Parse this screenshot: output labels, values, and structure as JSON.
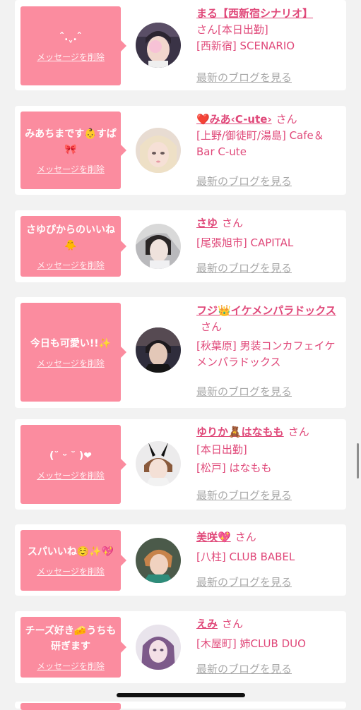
{
  "ui": {
    "delete_label": "メッセージを削除",
    "blog_label": "最新のブログを見る",
    "honorific": "さん"
  },
  "colors": {
    "bubble": "#fb8c9f",
    "accent": "#e0497a",
    "muted": "#a8a8a8",
    "background": "#f2f2f2"
  },
  "messages": [
    {
      "message": "ˆ.ˬ.ˆ",
      "name": "まる【西新宿シナリオ】",
      "shop_lines": [
        "[本日出勤]",
        "[西新宿] SCENARIO"
      ]
    },
    {
      "message": "みあちまです👶すぱ🎀",
      "name": "❤️みあ‹C-ute›",
      "shop_lines": [
        "[上野/御徒町/湯島] Cafe＆Bar C-ute"
      ]
    },
    {
      "message": "さゆぴからのいいね🐥",
      "name": "さゆ",
      "shop_lines": [
        "[尾張旭市] CAPITAL"
      ]
    },
    {
      "message": "今日も可愛い!!✨",
      "name": "フジ👑イケメンパラドックス",
      "shop_lines": [
        "[秋葉原] 男装コンカフェイケメンパラドックス"
      ]
    },
    {
      "message": "(˘ ᵕ ˘ )❤",
      "name": "ゆりか🧸はなもも",
      "shop_lines": [
        "[本日出勤]",
        "[松戸] はなもも"
      ]
    },
    {
      "message": "スパいいね☺️✨💖",
      "name": "美咲💖",
      "shop_lines": [
        "[八柱] CLUB BABEL"
      ]
    },
    {
      "message": "チーズ好き🧀うちも研ぎます",
      "name": "えみ",
      "shop_lines": [
        "[木屋町] 姉CLUB DUO"
      ]
    }
  ]
}
